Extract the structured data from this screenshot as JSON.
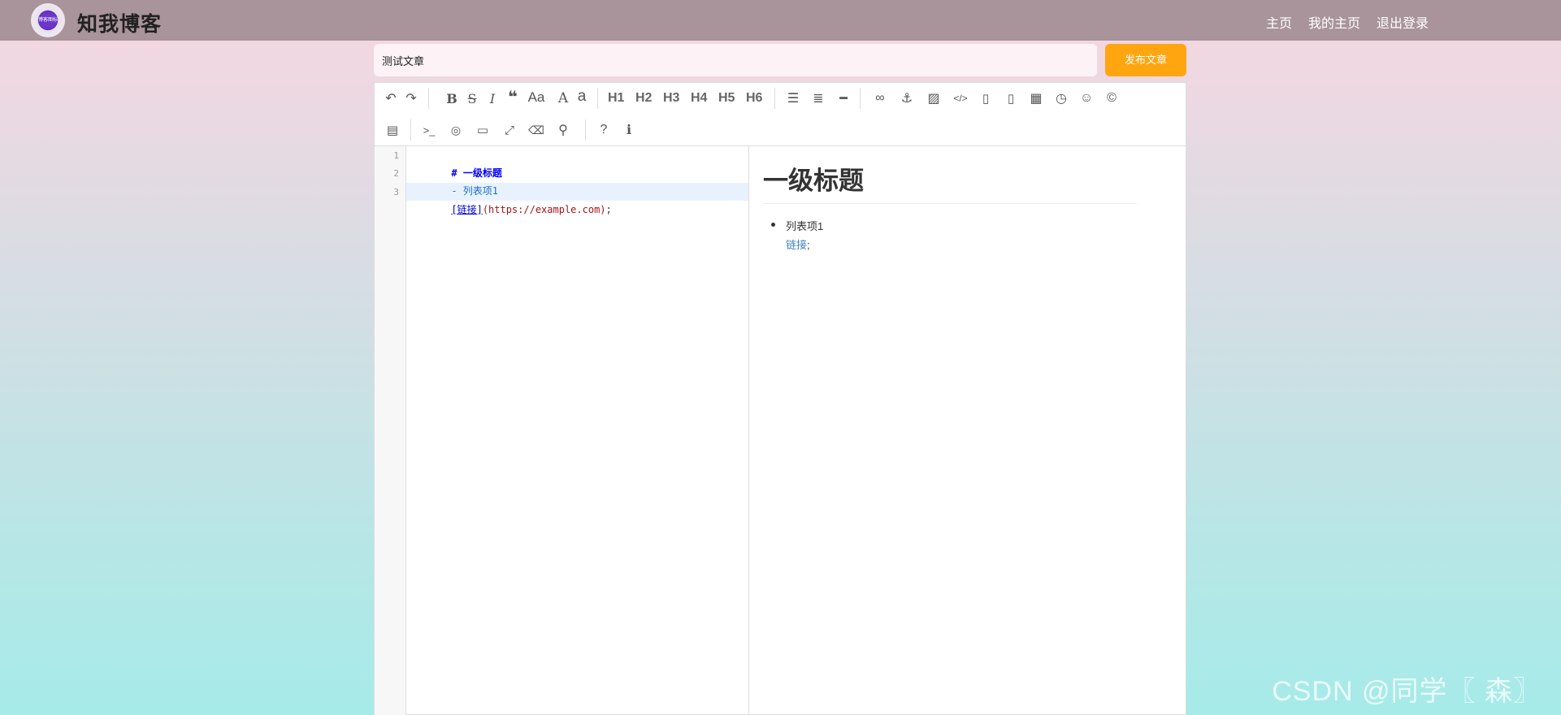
{
  "navbar": {
    "logo_text": "博客图标",
    "brand": "知我博客",
    "links": [
      "主页",
      "我的主页",
      "退出登录"
    ]
  },
  "editor_header": {
    "title_value": "测试文章",
    "publish_label": "发布文章"
  },
  "toolbar": {
    "headings": [
      "H1",
      "H2",
      "H3",
      "H4",
      "H5",
      "H6"
    ],
    "uppercase_label": "Aa",
    "font_a_upper": "A",
    "font_a_lower": "a",
    "bold_label": "B",
    "strike_label": "S",
    "italic_label": "I"
  },
  "code": {
    "line_numbers": [
      "1",
      "2",
      "3"
    ],
    "line1_marker": "# ",
    "line1_text": "一级标题",
    "line2_text": "- 列表项1",
    "line3_link": "[链接]",
    "line3_url": "(https://example.com)",
    "line3_tail": ";"
  },
  "preview": {
    "h1": "一级标题",
    "list_item": "列表项1",
    "link_text": "链接",
    "link_tail": ";"
  },
  "watermark": "CSDN @同学〖 森〗"
}
